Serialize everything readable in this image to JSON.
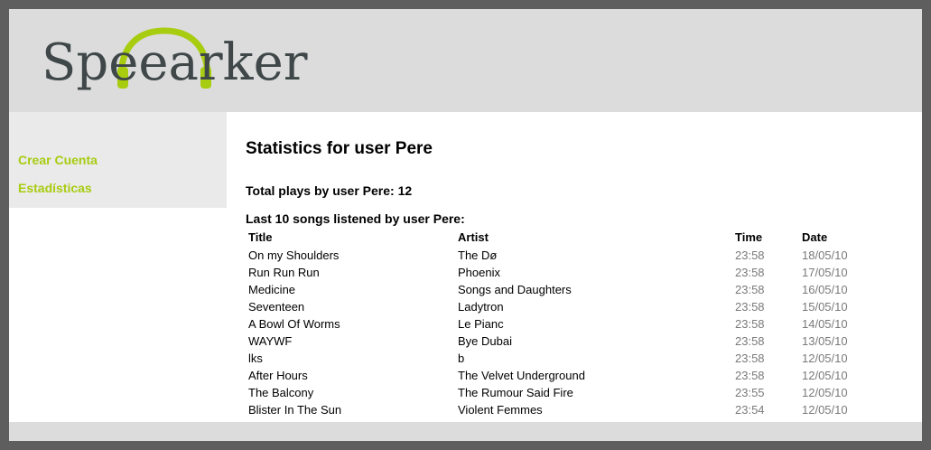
{
  "logo": {
    "text": "Speearker"
  },
  "sidebar": {
    "items": [
      {
        "label": "Crear Cuenta"
      },
      {
        "label": "Estadísticas"
      }
    ]
  },
  "main": {
    "title": "Statistics for user Pere",
    "total_label": "Total plays by user Pere: 12",
    "last_label": "Last 10 songs listened by user Pere:",
    "columns": [
      "Title",
      "Artist",
      "Time",
      "Date"
    ],
    "rows": [
      {
        "title": "On my Shoulders",
        "artist": "The Dø",
        "time": "23:58",
        "date": "18/05/10"
      },
      {
        "title": "Run Run Run",
        "artist": "Phoenix",
        "time": "23:58",
        "date": "17/05/10"
      },
      {
        "title": "Medicine",
        "artist": "Songs and Daughters",
        "time": "23:58",
        "date": "16/05/10"
      },
      {
        "title": "Seventeen",
        "artist": "Ladytron",
        "time": "23:58",
        "date": "15/05/10"
      },
      {
        "title": "A Bowl Of Worms",
        "artist": "Le Pianc",
        "time": "23:58",
        "date": "14/05/10"
      },
      {
        "title": "WAYWF",
        "artist": "Bye Dubai",
        "time": "23:58",
        "date": "13/05/10"
      },
      {
        "title": "lks",
        "artist": "b",
        "time": "23:58",
        "date": "12/05/10"
      },
      {
        "title": "After Hours",
        "artist": "The Velvet Underground",
        "time": "23:58",
        "date": "12/05/10"
      },
      {
        "title": "The Balcony",
        "artist": "The Rumour Said Fire",
        "time": "23:55",
        "date": "12/05/10"
      },
      {
        "title": "Blister In The Sun",
        "artist": "Violent Femmes",
        "time": "23:54",
        "date": "12/05/10"
      }
    ]
  },
  "colors": {
    "accent": "#a7cc10",
    "header_bg": "#dcdcdc",
    "sidebar_bg": "#eaeaea",
    "logo_text": "#3f4749"
  },
  "icons": {
    "logo_mark": "headphones-icon"
  }
}
